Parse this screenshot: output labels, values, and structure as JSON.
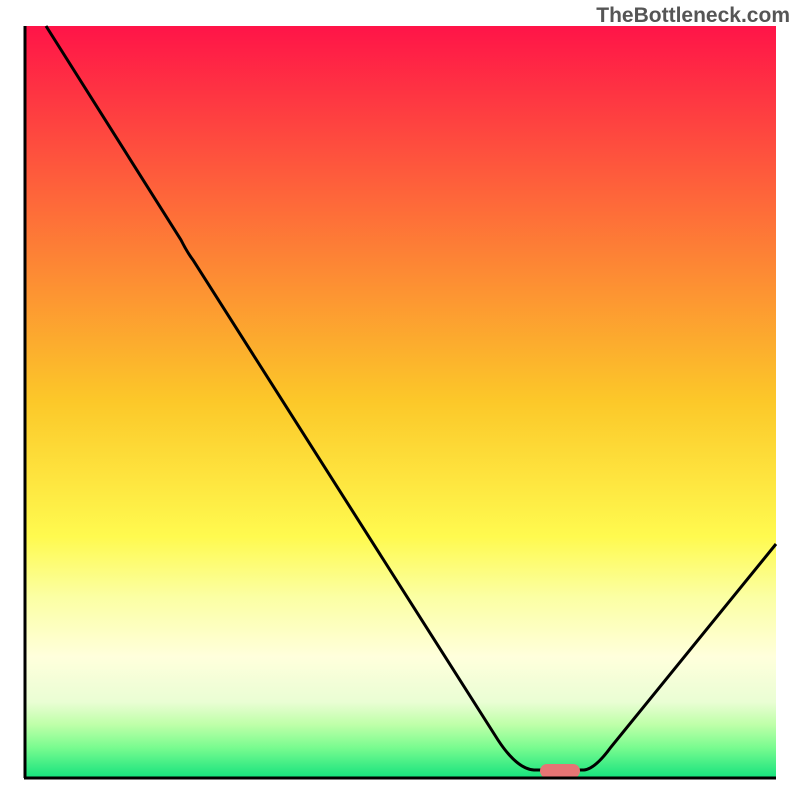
{
  "watermark": "TheBottleneck.com",
  "chart_data": {
    "type": "line",
    "title": "",
    "xlabel": "",
    "ylabel": "",
    "xlim": [
      0,
      100
    ],
    "ylim": [
      0,
      100
    ],
    "background": {
      "type": "vertical-gradient",
      "stops": [
        {
          "offset": 0,
          "color": "#ff1448"
        },
        {
          "offset": 50,
          "color": "#fcc829"
        },
        {
          "offset": 68,
          "color": "#fffa4f"
        },
        {
          "offset": 76,
          "color": "#fbffa3"
        },
        {
          "offset": 84,
          "color": "#ffffdc"
        },
        {
          "offset": 90,
          "color": "#eafed4"
        },
        {
          "offset": 93,
          "color": "#bfffa9"
        },
        {
          "offset": 96,
          "color": "#7bfc90"
        },
        {
          "offset": 100,
          "color": "#18e37e"
        }
      ]
    },
    "curve": {
      "description": "Bottleneck percentage curve dipping to a minimum",
      "points": [
        {
          "x": 3,
          "y": 100
        },
        {
          "x": 22,
          "y": 71
        },
        {
          "x": 65,
          "y": 3
        },
        {
          "x": 72,
          "y": 3
        },
        {
          "x": 100,
          "y": 34
        }
      ]
    },
    "marker": {
      "x": 70,
      "y": 3,
      "color": "#e67575",
      "shape": "rounded-pill"
    },
    "axes": {
      "color": "#000000",
      "thickness": 2
    }
  }
}
